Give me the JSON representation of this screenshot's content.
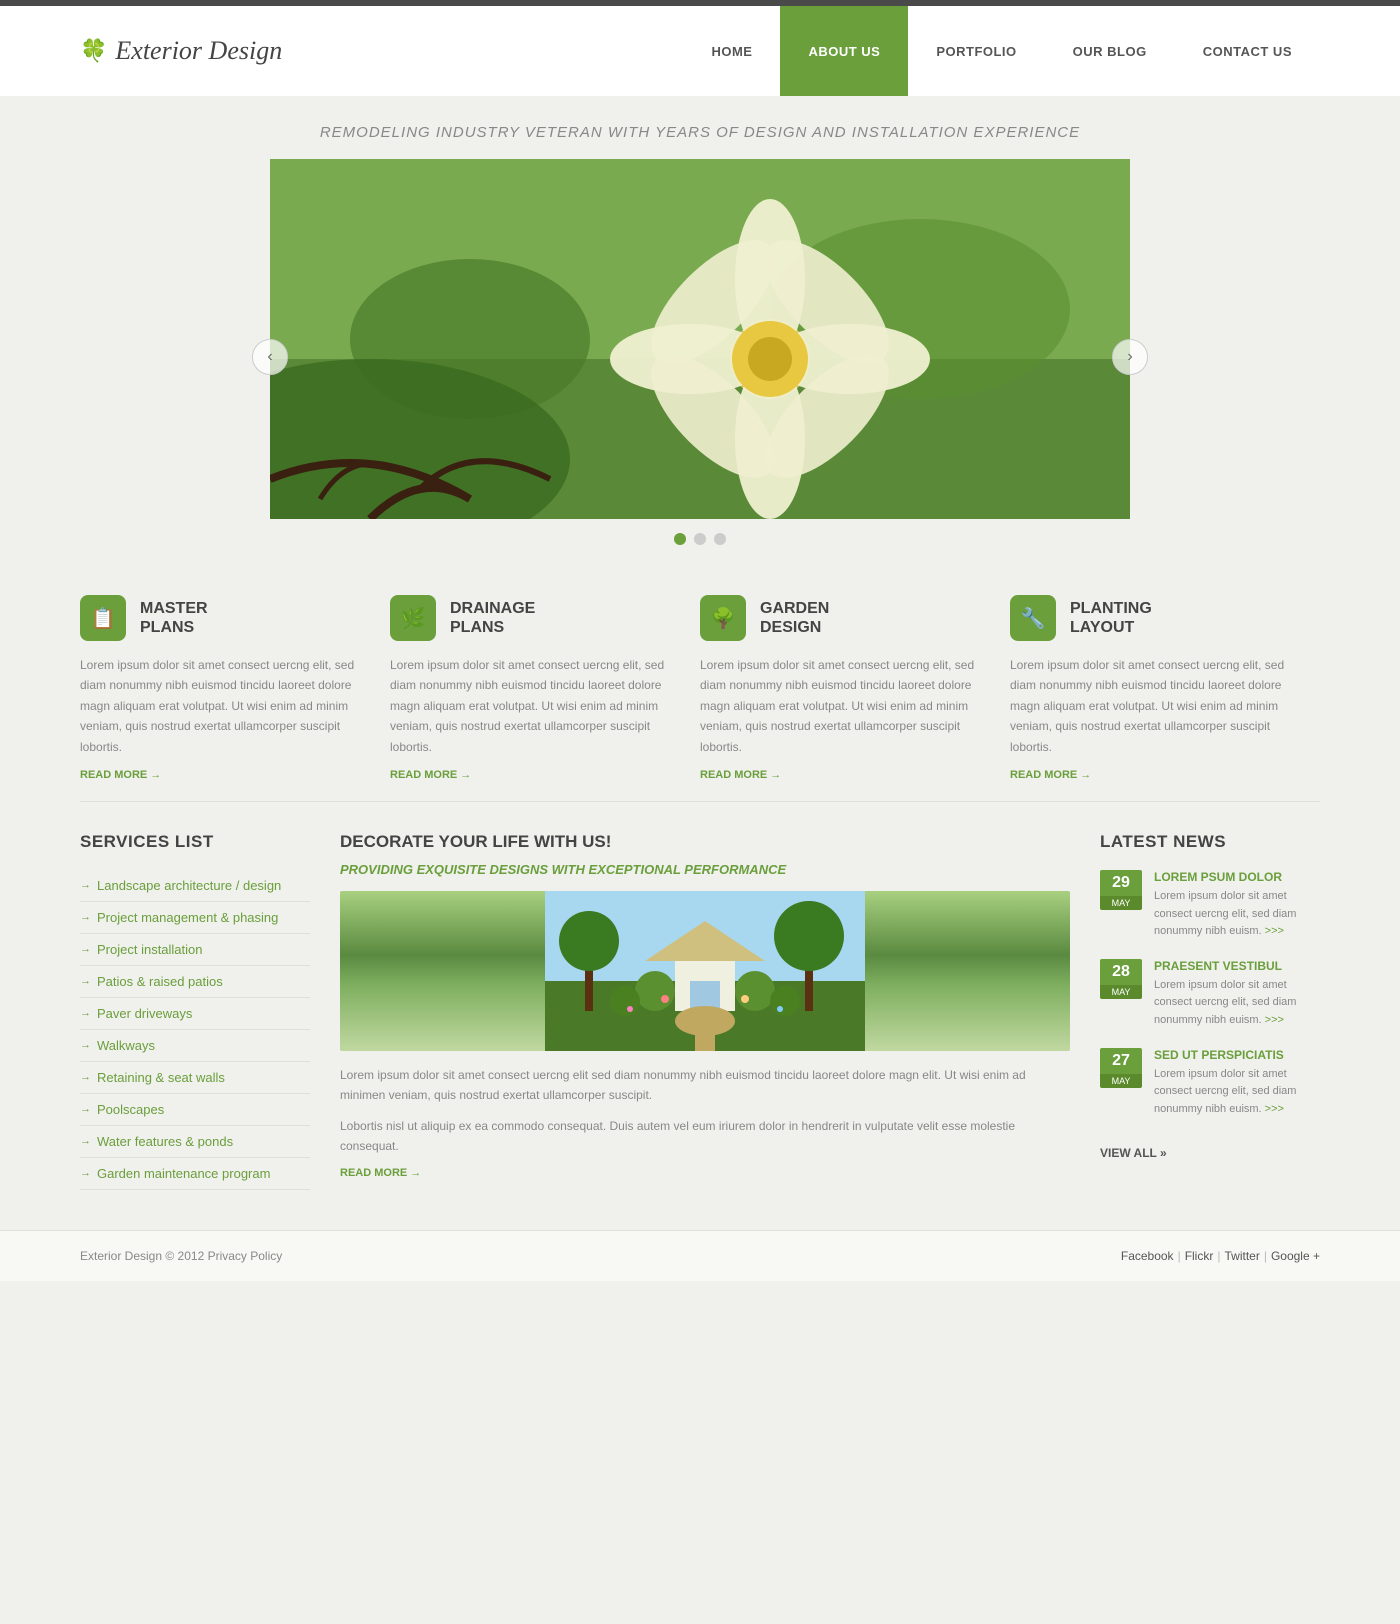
{
  "topbar": {},
  "header": {
    "logo_icon": "🍀",
    "logo_text": "Exterior Design",
    "nav": [
      {
        "id": "home",
        "label": "HOME",
        "active": false
      },
      {
        "id": "about",
        "label": "ABOUT US",
        "active": true
      },
      {
        "id": "portfolio",
        "label": "PORTFOLIO",
        "active": false
      },
      {
        "id": "blog",
        "label": "OUR BLOG",
        "active": false
      },
      {
        "id": "contact",
        "label": "CONTACT US",
        "active": false
      }
    ]
  },
  "hero": {
    "subtitle": "REMODELING INDUSTRY VETERAN WITH YEARS OF DESIGN AND INSTALLATION EXPERIENCE"
  },
  "slider": {
    "prev_label": "<",
    "next_label": ">",
    "dots": [
      1,
      2,
      3
    ],
    "active_dot": 0
  },
  "features": [
    {
      "id": "master-plans",
      "icon": "📋",
      "title": "MASTER\nPLANS",
      "text": "Lorem ipsum dolor sit amet consect uercng elit, sed diam nonummy nibh euismod tincidu laoreet dolore magn aliquam erat volutpat. Ut wisi enim ad minim veniam, quis nostrud exertat ullamcorper suscipit lobortis.",
      "read_more": "READ MORE →"
    },
    {
      "id": "drainage-plans",
      "icon": "🌿",
      "title": "DRAINAGE\nPLANS",
      "text": "Lorem ipsum dolor sit amet consect uercng elit, sed diam nonummy nibh euismod tincidu laoreet dolore magn aliquam erat volutpat. Ut wisi enim ad minim veniam, quis nostrud exertat ullamcorper suscipit lobortis.",
      "read_more": "READ MORE →"
    },
    {
      "id": "garden-design",
      "icon": "🌳",
      "title": "GARDEN\nDESIGN",
      "text": "Lorem ipsum dolor sit amet consect uercng elit, sed diam nonummy nibh euismod tincidu laoreet dolore magn aliquam erat volutpat. Ut wisi enim ad minim veniam, quis nostrud exertat ullamcorper suscipit lobortis.",
      "read_more": "READ MORE →"
    },
    {
      "id": "planting-layout",
      "icon": "🔧",
      "title": "PLANTING\nLAYOUT",
      "text": "Lorem ipsum dolor sit amet consect uercng elit, sed diam nonummy nibh euismod tincidu laoreet dolore magn aliquam erat volutpat. Ut wisi enim ad minim veniam, quis nostrud exertat ullamcorper suscipit lobortis.",
      "read_more": "READ MORE →"
    }
  ],
  "services": {
    "title": "SERVICES LIST",
    "items": [
      "Landscape architecture / design",
      "Project management & phasing",
      "Project installation",
      "Patios & raised patios",
      "Paver driveways",
      "Walkways",
      "Retaining & seat walls",
      "Poolscapes",
      "Water features & ponds",
      "Garden maintenance program"
    ]
  },
  "decorate": {
    "title": "DECORATE YOUR LIFE WITH US!",
    "subtitle": "PROVIDING EXQUISITE DESIGNS WITH EXCEPTIONAL PERFORMANCE",
    "text1": "Lorem ipsum dolor sit amet consect uercng elit sed diam nonummy nibh euismod tincidu laoreet dolore magn elit. Ut wisi enim ad minimen veniam, quis nostrud exertat ullamcorper suscipit.",
    "text2": "Lobortis nisl ut aliquip ex ea commodo consequat. Duis autem vel eum iriurem dolor in hendrerit in vulputate velit esse molestie consequat.",
    "read_more": "READ MORE →"
  },
  "news": {
    "title": "LATEST NEWS",
    "items": [
      {
        "day": "29",
        "month": "MAY",
        "title": "LOREM PSUM DOLOR",
        "text": "Lorem ipsum dolor sit amet consect uercng elit, sed diam nonummy nibh euism.",
        "link": ">>>"
      },
      {
        "day": "28",
        "month": "MAY",
        "title": "PRAESENT VESTIBUL",
        "text": "Lorem ipsum dolor sit amet consect uercng elit, sed diam nonummy nibh euism.",
        "link": ">>>"
      },
      {
        "day": "27",
        "month": "MAY",
        "title": "SED UT PERSPICIATIS",
        "text": "Lorem ipsum dolor sit amet consect uercng elit, sed diam nonummy nibh euism.",
        "link": ">>>"
      }
    ],
    "view_all": "VIEW ALL »"
  },
  "footer": {
    "copyright": "Exterior Design © 2012 Privacy Policy",
    "links": [
      "Facebook",
      "Flickr",
      "Twitter",
      "Google +"
    ],
    "separators": [
      "|",
      "|",
      "|"
    ]
  }
}
